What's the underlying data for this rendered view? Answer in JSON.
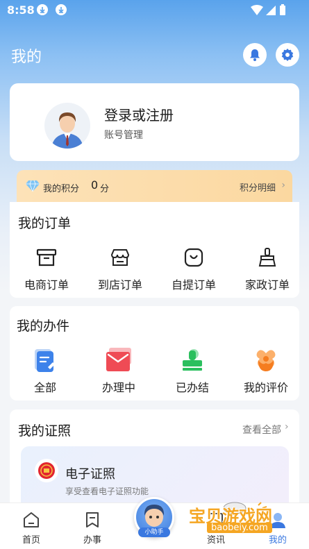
{
  "status_bar": {
    "time": "8:58"
  },
  "header": {
    "title": "我的"
  },
  "profile": {
    "login_title": "登录或注册",
    "account_mgmt": "账号管理"
  },
  "points": {
    "label": "我的积分",
    "value": "0",
    "unit": "分",
    "detail_link": "积分明细"
  },
  "orders": {
    "title": "我的订单",
    "items": [
      {
        "label": "电商订单",
        "icon": "archive-box-icon"
      },
      {
        "label": "到店订单",
        "icon": "storefront-icon"
      },
      {
        "label": "自提订单",
        "icon": "bag-icon"
      },
      {
        "label": "家政订单",
        "icon": "broom-icon"
      }
    ]
  },
  "tasks": {
    "title": "我的办件",
    "items": [
      {
        "label": "全部",
        "icon": "document-edit-icon"
      },
      {
        "label": "办理中",
        "icon": "envelope-icon"
      },
      {
        "label": "已办结",
        "icon": "stamp-icon"
      },
      {
        "label": "我的评价",
        "icon": "flower-icon"
      }
    ]
  },
  "certificates": {
    "title": "我的证照",
    "see_all": "查看全部",
    "card_title": "电子证照",
    "card_subtitle": "享受查看电子证照功能"
  },
  "nav": {
    "items": [
      {
        "label": "首页",
        "icon": "home-icon"
      },
      {
        "label": "办事",
        "icon": "bookmark-icon"
      },
      {
        "label": "资讯",
        "icon": "news-icon"
      },
      {
        "label": "我的",
        "icon": "user-icon"
      }
    ],
    "assistant_label": "小助手"
  },
  "watermark": {
    "text": "宝贝游戏网",
    "url": "baobeiy.com"
  },
  "colors": {
    "accent": "#3a78e0",
    "orange": "#f5a623",
    "red": "#ef4b55",
    "green": "#2bbf5e",
    "blue": "#3d82ea"
  }
}
